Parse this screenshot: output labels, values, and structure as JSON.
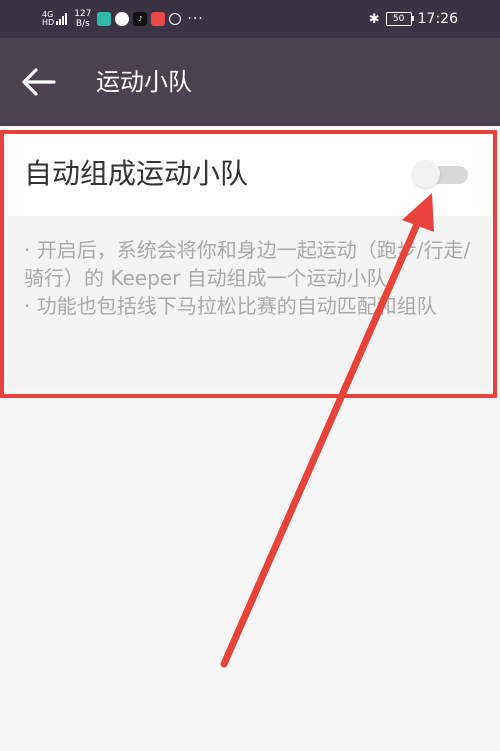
{
  "status_bar": {
    "network": "4G",
    "network_sub": "HD",
    "speed_value": "127",
    "speed_unit": "B/s",
    "battery": "50",
    "time": "17:26"
  },
  "header": {
    "title": "运动小队"
  },
  "setting": {
    "title": "自动组成运动小队",
    "enabled": false,
    "desc_line1": "· 开启后，系统会将你和身边一起运动（跑步/行走/骑行）的 Keeper 自动组成一个运动小队",
    "desc_line2": "· 功能也包括线下马拉松比赛的自动匹配和组队"
  },
  "colors": {
    "status_bar_bg": "#3a3345",
    "header_bg": "#4a4250",
    "highlight": "#e8433a"
  }
}
